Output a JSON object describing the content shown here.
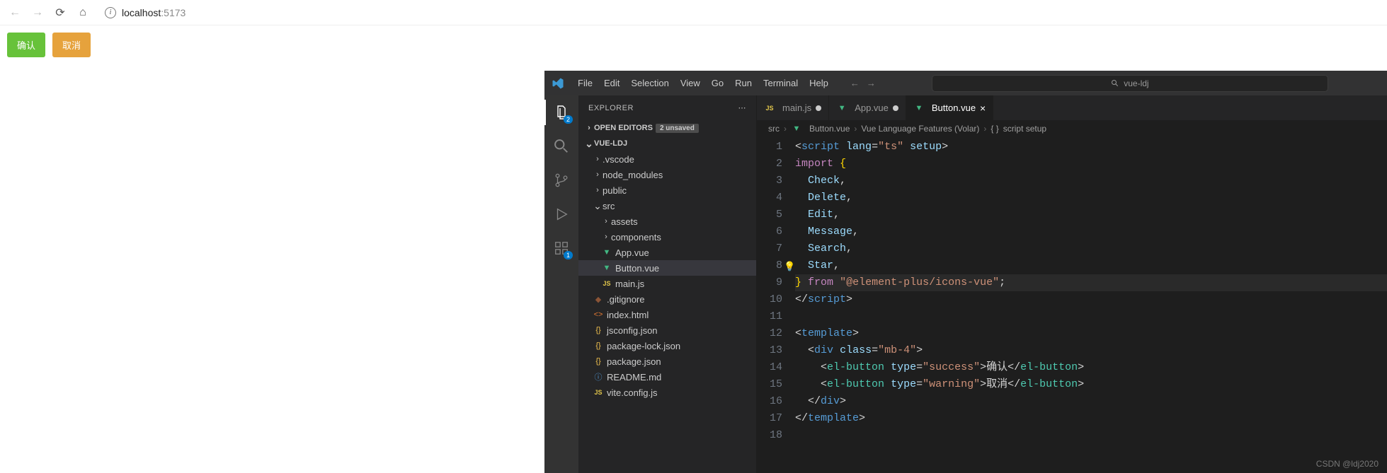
{
  "browser": {
    "host": "localhost",
    "port": ":5173"
  },
  "page": {
    "confirm": "确认",
    "cancel": "取消"
  },
  "vscode": {
    "menu": [
      "File",
      "Edit",
      "Selection",
      "View",
      "Go",
      "Run",
      "Terminal",
      "Help"
    ],
    "search_placeholder": "vue-ldj",
    "activity_badges": {
      "explorer": "2",
      "extensions": "1"
    },
    "explorer": {
      "title": "EXPLORER",
      "open_editors": "OPEN EDITORS",
      "unsaved_count": "2 unsaved",
      "project": "VUE-LDJ",
      "tree": {
        "vscode_dir": ".vscode",
        "node_modules": "node_modules",
        "public": "public",
        "src": "src",
        "assets": "assets",
        "components": "components",
        "app_vue": "App.vue",
        "button_vue": "Button.vue",
        "main_js": "main.js",
        "gitignore": ".gitignore",
        "index_html": "index.html",
        "jsconfig": "jsconfig.json",
        "pkg_lock": "package-lock.json",
        "pkg": "package.json",
        "readme": "README.md",
        "vite_cfg": "vite.config.js"
      }
    },
    "tabs": {
      "main_js": "main.js",
      "app_vue": "App.vue",
      "button_vue": "Button.vue"
    },
    "crumbs": {
      "src": "src",
      "file": "Button.vue",
      "feature": "Vue Language Features (Volar)",
      "scope": "script setup"
    },
    "code": {
      "l1_open": "<",
      "l1_script": "script",
      "l1_lang": "lang",
      "l1_eq": "=",
      "l1_ts": "\"ts\"",
      "l1_setup": "setup",
      "l1_close": ">",
      "l2_import": "import",
      "l2_brace": "{",
      "l3": "Check",
      "l3c": ",",
      "l4": "Delete",
      "l4c": ",",
      "l5": "Edit",
      "l5c": ",",
      "l6": "Message",
      "l6c": ",",
      "l7": "Search",
      "l7c": ",",
      "l8": "Star",
      "l8c": ",",
      "l9_brace": "}",
      "l9_from": "from",
      "l9_pkg": "\"@element-plus/icons-vue\"",
      "l9_semi": ";",
      "l10_open": "</",
      "l10_script": "script",
      "l10_close": ">",
      "l12_open": "<",
      "l12_tpl": "template",
      "l12_close": ">",
      "l13_open": "<",
      "l13_div": "div",
      "l13_cls": "class",
      "l13_eq": "=",
      "l13_val": "\"mb-4\"",
      "l13_close": ">",
      "l14_open": "<",
      "l14_el": "el-button",
      "l14_type": "type",
      "l14_eq": "=",
      "l14_val": "\"success\"",
      "l14_close": ">",
      "l14_txt": "确认",
      "l14_c1": "</",
      "l14_c2": ">",
      "l15_open": "<",
      "l15_el": "el-button",
      "l15_type": "type",
      "l15_eq": "=",
      "l15_val": "\"warning\"",
      "l15_close": ">",
      "l15_txt": "取消",
      "l15_c1": "</",
      "l15_c2": ">",
      "l16_open": "</",
      "l16_div": "div",
      "l16_close": ">",
      "l17_open": "</",
      "l17_tpl": "template",
      "l17_close": ">"
    },
    "line_numbers": [
      "1",
      "2",
      "3",
      "4",
      "5",
      "6",
      "7",
      "8",
      "9",
      "10",
      "11",
      "12",
      "13",
      "14",
      "15",
      "16",
      "17",
      "18"
    ]
  },
  "watermark": "CSDN @ldj2020"
}
